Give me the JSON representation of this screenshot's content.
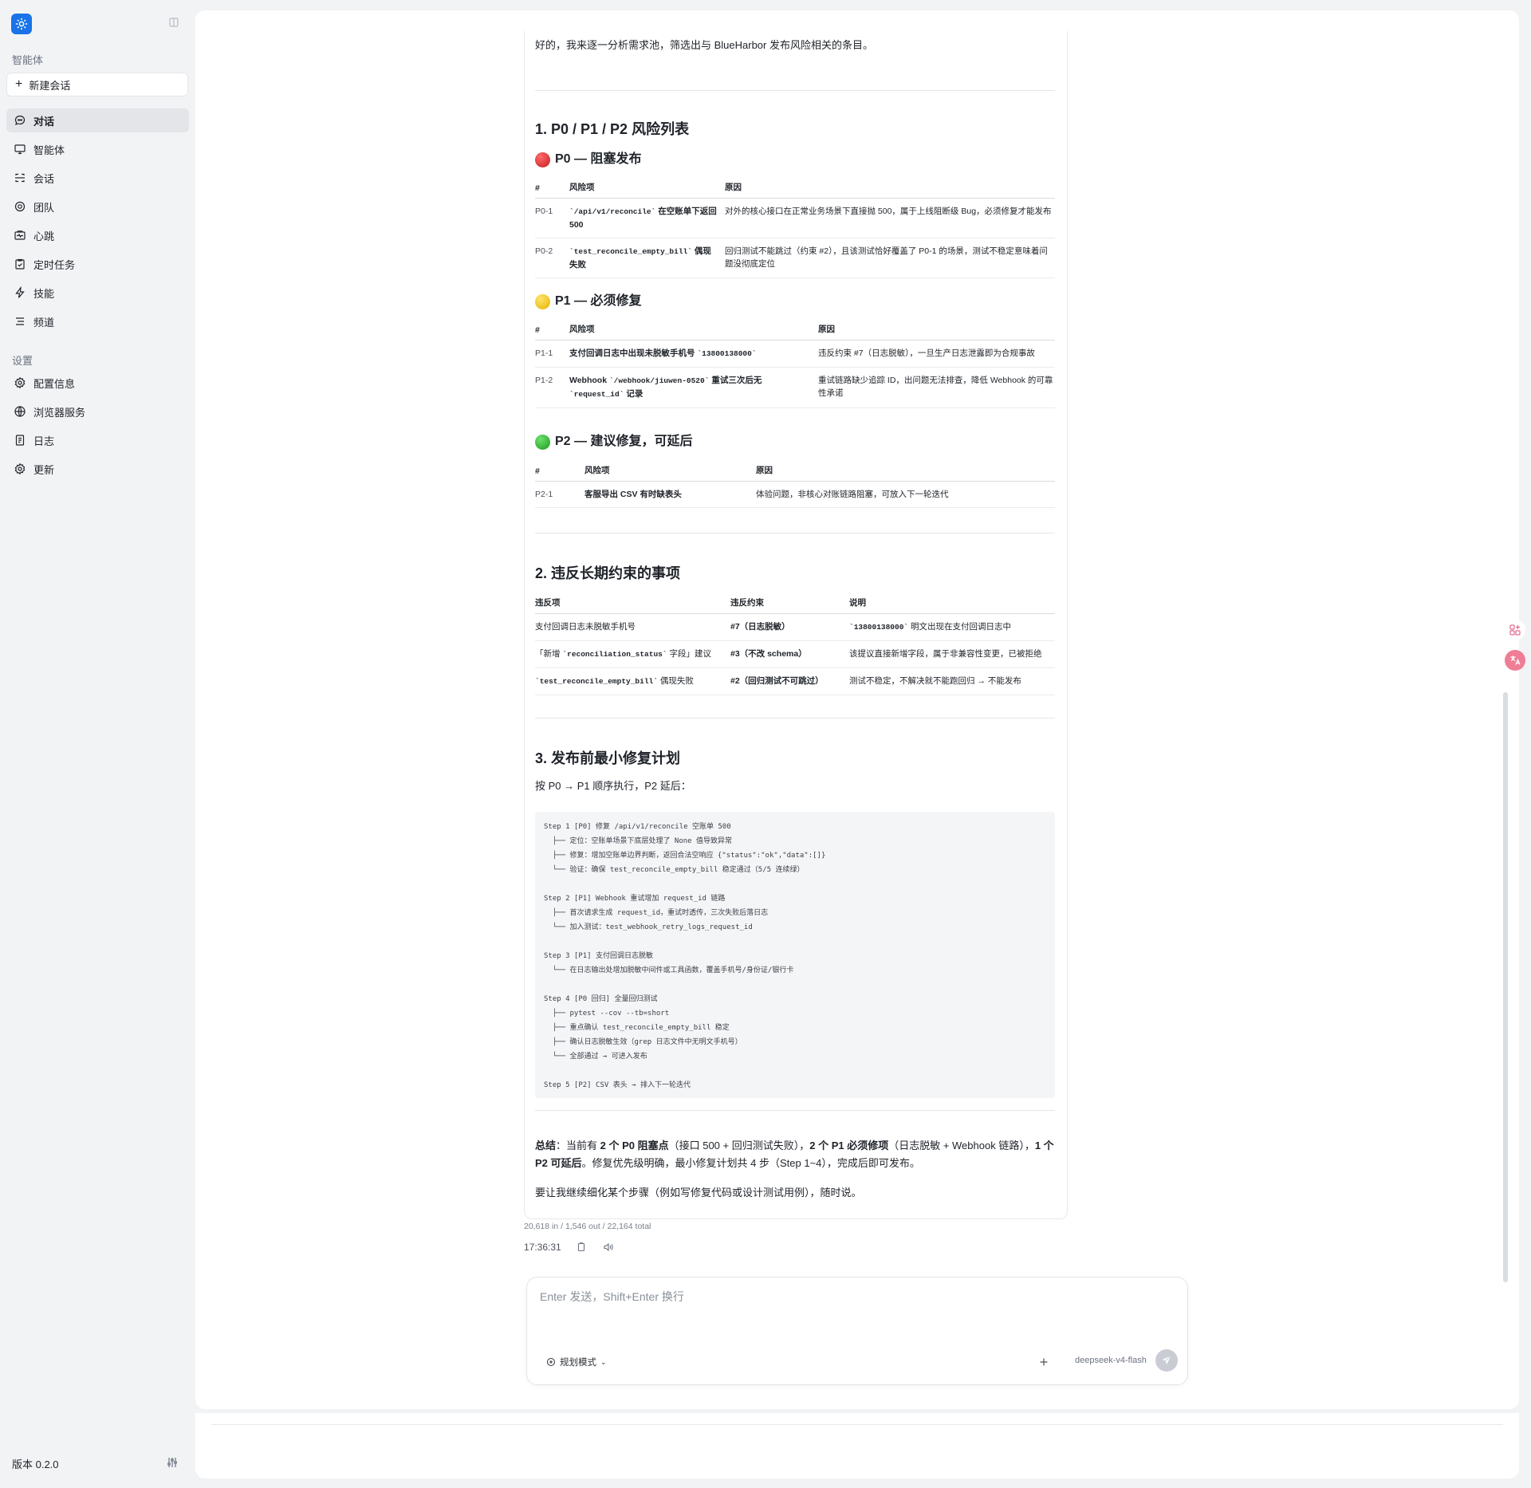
{
  "sidebar": {
    "agent_section": "智能体",
    "new_chat": "新建会话",
    "nav": [
      {
        "label": "对话",
        "icon": "chat-bubble-icon"
      },
      {
        "label": "智能体",
        "icon": "monitor-icon"
      },
      {
        "label": "会话",
        "icon": "session-icon"
      },
      {
        "label": "团队",
        "icon": "team-icon"
      },
      {
        "label": "心跳",
        "icon": "heartbeat-icon"
      },
      {
        "label": "定时任务",
        "icon": "clipboard-check-icon"
      },
      {
        "label": "技能",
        "icon": "lightning-icon"
      },
      {
        "label": "频道",
        "icon": "list-icon"
      }
    ],
    "settings_section": "设置",
    "settings": [
      {
        "label": "配置信息",
        "icon": "gear-icon"
      },
      {
        "label": "浏览器服务",
        "icon": "globe-icon"
      },
      {
        "label": "日志",
        "icon": "document-icon"
      },
      {
        "label": "更新",
        "icon": "gear-icon"
      }
    ],
    "version": "版本 0.2.0"
  },
  "message": {
    "intro": "好的，我来逐一分析需求池，筛选出与 BlueHarbor 发布风险相关的条目。",
    "section1_title": "1. P0 / P1 / P2 风险列表",
    "p0": {
      "title": "P0 — 阻塞发布",
      "headers": [
        "#",
        "风险项",
        "原因"
      ],
      "rows": [
        {
          "id": "P0-1",
          "item_code": "`/api/v1/reconcile`",
          "item_text": " 在空账单下返回 500",
          "reason": "对外的核心接口在正常业务场景下直接抛 500，属于上线阻断级 Bug，必须修复才能发布"
        },
        {
          "id": "P0-2",
          "item_code": "`test_reconcile_empty_bill`",
          "item_text": " 偶现失败",
          "reason": "回归测试不能跳过（约束 #2），且该测试恰好覆盖了 P0-1 的场景，测试不稳定意味着问题没彻底定位"
        }
      ]
    },
    "p1": {
      "title": "P1 — 必须修复",
      "headers": [
        "#",
        "风险项",
        "原因"
      ],
      "rows": [
        {
          "id": "P1-1",
          "item_text": "支付回调日志中出现未脱敏手机号 ",
          "item_code": "`13800138000`",
          "reason": "违反约束 #7（日志脱敏），一旦生产日志泄露即为合规事故"
        },
        {
          "id": "P1-2",
          "item_pre": "Webhook ",
          "item_code": "`/webhook/jiuwen-0520`",
          "item_text": " 重试三次后无 ",
          "item_code2": "`request_id`",
          "item_post": " 记录",
          "reason": "重试链路缺少追踪 ID，出问题无法排查，降低 Webhook 的可靠性承诺"
        }
      ]
    },
    "p2": {
      "title": "P2 — 建议修复，可延后",
      "headers": [
        "#",
        "风险项",
        "原因"
      ],
      "rows": [
        {
          "id": "P2-1",
          "item_text": "客服导出 CSV 有时缺表头",
          "reason": "体验问题，非核心对账链路阻塞，可放入下一轮迭代"
        }
      ]
    },
    "section2_title": "2. 违反长期约束的事项",
    "section2": {
      "headers": [
        "违反项",
        "违反约束",
        "说明"
      ],
      "rows": [
        {
          "item": "支付回调日志未脱敏手机号",
          "constraint": "#7（日志脱敏）",
          "note_code": "`13800138000`",
          "note": " 明文出现在支付回调日志中"
        },
        {
          "item_pre": "「新增 ",
          "item_code": "`reconciliation_status`",
          "item_post": " 字段」建议",
          "constraint": "#3（不改 schema）",
          "note": "该提议直接新增字段，属于非兼容性变更，已被拒绝"
        },
        {
          "item_code": "`test_reconcile_empty_bill`",
          "item_post": " 偶现失败",
          "constraint": "#2（回归测试不可跳过）",
          "note": "测试不稳定，不解决就不能跑回归 → 不能发布"
        }
      ]
    },
    "section3_title": "3. 发布前最小修复计划",
    "section3_intro": "按 P0 → P1 顺序执行，P2 延后：",
    "code": "Step 1 [P0] 修复 /api/v1/reconcile 空账单 500\n  ├── 定位：空账单场景下底层处理了 None 值导致异常\n  ├── 修复：增加空账单边界判断，返回合法空响应 {\"status\":\"ok\",\"data\":[]}\n  └── 验证：确保 test_reconcile_empty_bill 稳定通过（5/5 连续绿）\n\nStep 2 [P1] Webhook 重试增加 request_id 链路\n  ├── 首次请求生成 request_id，重试时透传，三次失败后落日志\n  └── 加入测试：test_webhook_retry_logs_request_id\n\nStep 3 [P1] 支付回调日志脱敏\n  └── 在日志输出处增加脱敏中间件或工具函数，覆盖手机号/身份证/银行卡\n\nStep 4 [P0 回归] 全量回归测试\n  ├── pytest --cov --tb=short\n  ├── 重点确认 test_reconcile_empty_bill 稳定\n  ├── 确认日志脱敏生效（grep 日志文件中无明文手机号）\n  └── 全部通过 → 可进入发布\n\nStep 5 [P2] CSV 表头 → 排入下一轮迭代",
    "summary": {
      "label": "总结",
      "t1": "：当前有 ",
      "b1": "2 个 P0 阻塞点",
      "t2": "（接口 500 + 回归测试失败），",
      "b2": "2 个 P1 必须修项",
      "t3": "（日志脱敏 + Webhook 链路），",
      "b3": "1 个 P2 可延后",
      "t4": "。修复优先级明确，最小修复计划共 4 步（Step 1~4），完成后即可发布。"
    },
    "closing": "要让我继续细化某个步骤（例如写修复代码或设计测试用例），随时说。",
    "tokens": "20,618 in / 1,546 out / 22,164 total",
    "time": "17:36:31"
  },
  "composer": {
    "placeholder": "Enter 发送，Shift+Enter 换行",
    "mode": "规划模式",
    "model": "deepseek-v4-flash"
  },
  "colors": {
    "accent": "#1a73e8",
    "p0": "#d32020",
    "p1": "#f2c200",
    "p2": "#23a823"
  }
}
